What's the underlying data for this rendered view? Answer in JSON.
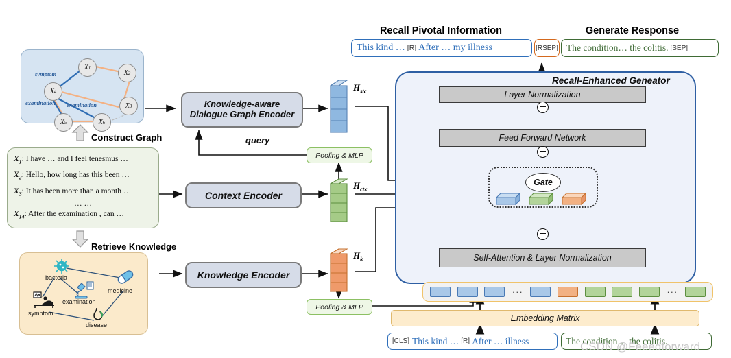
{
  "headers": {
    "recall": "Recall Pivotal Information",
    "generate": "Generate Response"
  },
  "top_sequence": {
    "recall_text_1": "This kind …",
    "recall_tag": "[R]",
    "recall_text_2": "After … my illness",
    "rsep": "[RSEP]",
    "response_text": "The condition…  the colitis.",
    "sep": "[SEP]"
  },
  "dialogue_graph": {
    "nodes": [
      {
        "id": "X1",
        "label": "X",
        "sub": "1"
      },
      {
        "id": "X2",
        "label": "X",
        "sub": "2"
      },
      {
        "id": "X3",
        "label": "X",
        "sub": "3"
      },
      {
        "id": "X4",
        "label": "X",
        "sub": "4"
      },
      {
        "id": "X5",
        "label": "X",
        "sub": "5"
      },
      {
        "id": "X6",
        "label": "X",
        "sub": "6"
      }
    ],
    "edge_labels": [
      "symptom",
      "examination",
      "examination"
    ],
    "ellipsis": "· · ·"
  },
  "construct_graph_label": "Construct Graph",
  "retrieve_knowledge_label": "Retrieve Knowledge",
  "context_panel": {
    "lines": [
      {
        "var": "X",
        "sub": "1",
        "text": ": I have … and I feel tenesmus …"
      },
      {
        "var": "X",
        "sub": "2",
        "text": ": Hello, how long has this been …"
      },
      {
        "var": "X",
        "sub": "3",
        "text": ": It has been more than a month …"
      },
      {
        "var": "X",
        "sub": "14",
        "text": ": After the examination , can …"
      }
    ],
    "ellipsis": "… …"
  },
  "knowledge_panel": {
    "nodes": [
      {
        "label": "bacteria",
        "icon": "virus-icon"
      },
      {
        "label": "medicine",
        "icon": "capsule-icon"
      },
      {
        "label": "examination",
        "icon": "microscope-icon"
      },
      {
        "label": "symptom",
        "icon": "patient-bed-icon"
      },
      {
        "label": "disease",
        "icon": "stomach-icon"
      }
    ]
  },
  "encoders": {
    "graph_encoder_line1": "Knowledge-aware",
    "graph_encoder_line2": "Dialogue Graph Encoder",
    "context_encoder": "Context Encoder",
    "knowledge_encoder": "Knowledge Encoder"
  },
  "query_label": "query",
  "pooling_label": "Pooling & MLP",
  "tensors": {
    "stc": {
      "name": "H",
      "sub": "stc",
      "color": "#8ab4df"
    },
    "ctx": {
      "name": "H",
      "sub": "ctx",
      "color": "#9fc97e"
    },
    "k": {
      "name": "H",
      "sub": "k",
      "color": "#ef9a6a"
    }
  },
  "generator": {
    "title": "Recall-Enhanced Geneator",
    "layer_norm": "Layer Normalization",
    "feed_forward": "Feed Forward Network",
    "self_attention": "Self-Attention & Layer Normalization",
    "gate": "Gate"
  },
  "embedding": {
    "matrix_label": "Embedding Matrix",
    "tokens": [
      "blue",
      "blue",
      "blue",
      "dots",
      "blue",
      "orange",
      "green",
      "green",
      "green",
      "dots",
      "green"
    ]
  },
  "bottom_sequence": {
    "cls": "[CLS]",
    "text_1": "This kind …",
    "r_tag": "[R]",
    "text_2": "After … illness",
    "response": "The condition…  the colitis."
  },
  "watermark": "CSDN @Feeedforward",
  "colors": {
    "blue_text": "#2f6fba",
    "green_text": "#3f6b35",
    "orange": "#d4691e",
    "gen_border": "#2e5fa3"
  }
}
